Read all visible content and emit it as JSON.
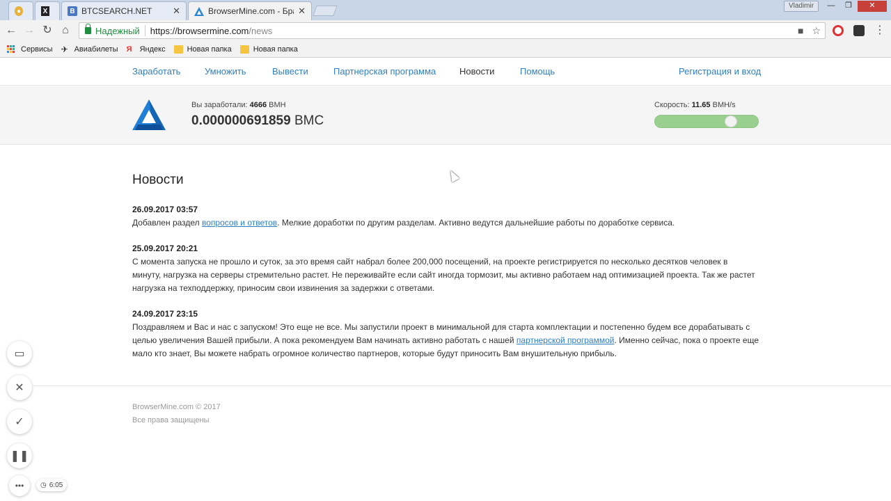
{
  "browser": {
    "tabs": [
      {
        "title": "",
        "icon": "coin-icon",
        "color": "#e8b23a"
      },
      {
        "title": "",
        "icon": "x-icon",
        "color": "#222222"
      },
      {
        "title": "BTCSEARCH.NET",
        "icon": "b-icon",
        "color": "#4a76c6"
      },
      {
        "title": "BrowserMine.com - Брау",
        "icon": "browsermine-icon",
        "color": "#2a86d4"
      }
    ],
    "profile_name": "Vladimir",
    "security_label": "Надежный",
    "url_host": "https://browsermine.com",
    "url_path": "/news",
    "bookmarks": [
      {
        "label": "Сервисы",
        "icon": "apps-icon"
      },
      {
        "label": "Авиабилеты",
        "icon": "plane-icon"
      },
      {
        "label": "Яндекс",
        "icon": "yandex-icon"
      },
      {
        "label": "Новая папка",
        "icon": "folder-icon"
      },
      {
        "label": "Новая папка",
        "icon": "folder-icon"
      }
    ]
  },
  "nav": {
    "items": [
      "Заработать",
      "Умножить",
      "Вывести",
      "Партнерская программа",
      "Новости",
      "Помощь"
    ],
    "active": "Новости",
    "auth": "Регистрация и вход"
  },
  "stats": {
    "earned_label": "Вы заработали:",
    "earned_value": "4666",
    "earned_unit": "BMH",
    "balance_value": "0.000000691859",
    "balance_unit": "BMC",
    "speed_label": "Скорость:",
    "speed_value": "11.65",
    "speed_unit": "BMH/s",
    "speed_level": 0.77,
    "accent_color": "#9ad08f"
  },
  "news": {
    "title": "Новости",
    "items": [
      {
        "date": "26.09.2017 03:57",
        "text_before": "Добавлен раздел ",
        "link": "вопросов и ответов",
        "text_after": ". Мелкие доработки по другим разделам. Активно ведутся дальнейшие работы по доработке сервиса."
      },
      {
        "date": "25.09.2017 20:21",
        "text_before": "С момента запуска не прошло и суток, за это время сайт набрал более 200,000 посещений, на проекте регистрируется по несколько десятков человек в минуту, нагрузка на серверы стремительно растет. Не переживайте если сайт иногда тормозит, мы активно работаем над оптимизацией проекта. Так же растет нагрузка на техподдержку, приносим свои извинения за задержки с ответами.",
        "link": "",
        "text_after": ""
      },
      {
        "date": "24.09.2017 23:15",
        "text_before": "Поздравляем и Вас и нас с запуском! Это еще не все. Мы запустили проект в минимальной для старта комплектации и постепенно будем все дорабатывать с целью увеличения Вашей прибыли. А пока рекомендуем Вам начинать активно работать с нашей ",
        "link": "партнерской программой",
        "text_after": ". Именно сейчас, пока о проекте еще мало кто знает, Вы можете набрать огромное количество партнеров, которые будут приносить Вам внушительную прибыль."
      }
    ]
  },
  "footer": {
    "copyright": "BrowserMine.com © 2017",
    "rights": "Все права защищены"
  },
  "recorder": {
    "timer": "6:05"
  }
}
